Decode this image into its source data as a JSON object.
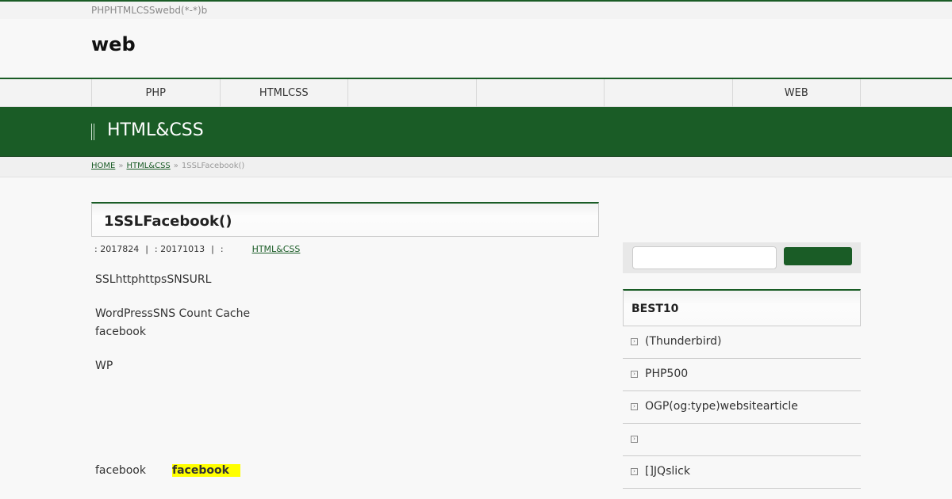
{
  "header": {
    "tagline": "PHPHTMLCSSwebd(*-*)b",
    "site_title": "web"
  },
  "nav": {
    "items": [
      {
        "label": "PHP"
      },
      {
        "label": "HTMLCSS"
      },
      {
        "label": ""
      },
      {
        "label": ""
      },
      {
        "label": ""
      },
      {
        "label": "WEB"
      }
    ]
  },
  "category": {
    "title": "HTML&CSS"
  },
  "breadcrumb": {
    "home": "HOME",
    "sep": "»",
    "category": "HTML&CSS",
    "current": "1SSLFacebook()"
  },
  "post": {
    "title": "1SSLFacebook()",
    "meta": {
      "published": ": 2017824",
      "pipe": "|",
      "updated": ": 20171013",
      "category_label": ":",
      "category_link": "HTML&CSS"
    },
    "body": {
      "line1": "SSLhttphttpsSNSURL",
      "line2a": "WordPressSNS Count Cache",
      "line2b": "facebook",
      "line3": "WP"
    },
    "fb_row": {
      "text": "facebook",
      "highlight": "facebook"
    }
  },
  "sidebar": {
    "search": {
      "placeholder": "",
      "button_label": ""
    },
    "best10": {
      "title": "BEST10",
      "icon": "arrow-box-icon",
      "items": [
        {
          "label": "(Thunderbird)"
        },
        {
          "label": "PHP500"
        },
        {
          "label": "OGP(og:type)websitearticle"
        },
        {
          "label": ""
        },
        {
          "label": "[]JQslick"
        }
      ]
    }
  },
  "colors": {
    "accent": "#1a5c26",
    "highlight": "#ffff00",
    "background": "#f8f8f8"
  }
}
